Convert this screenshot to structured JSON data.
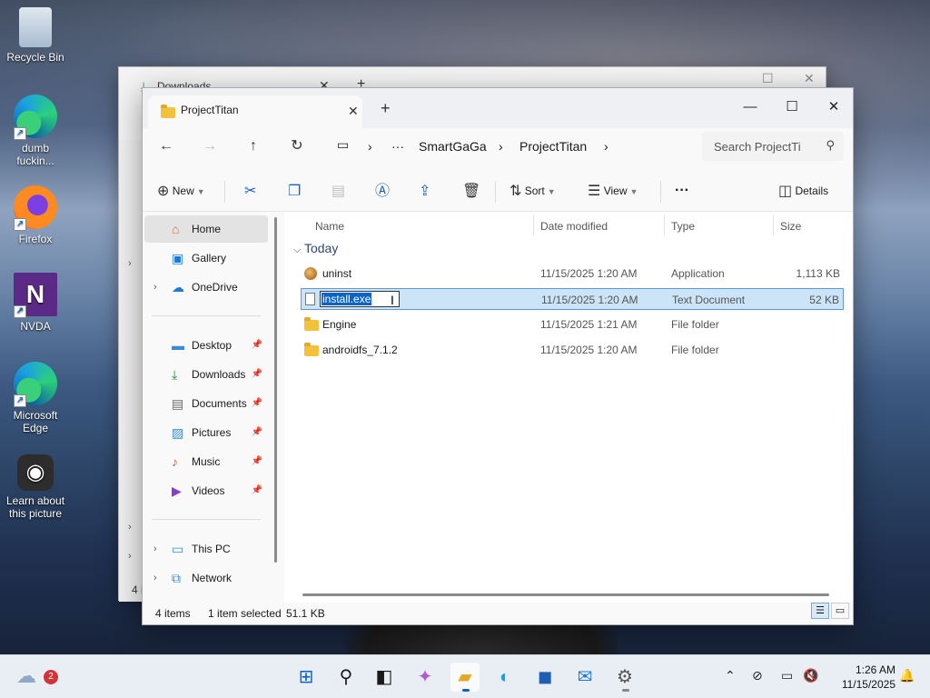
{
  "desktop": {
    "icons": [
      {
        "label": "Recycle Bin",
        "icon": "recycle-bin-icon"
      },
      {
        "label": "dumb fuckin...",
        "icon": "edge-icon"
      },
      {
        "label": "Firefox",
        "icon": "firefox-icon"
      },
      {
        "label": "NVDA",
        "icon": "nvda-icon"
      },
      {
        "label": "Microsoft Edge",
        "icon": "edge-icon"
      },
      {
        "label": "Learn about this picture",
        "icon": "learn-picture-icon"
      }
    ]
  },
  "back_window": {
    "tab_title": "Downloads",
    "footer": "4 i"
  },
  "window": {
    "tab_title": "ProjectTitan",
    "breadcrumb": [
      "SmartGaGa",
      "ProjectTitan"
    ],
    "search_placeholder": "Search ProjectTi",
    "commands": {
      "new": "New",
      "sort": "Sort",
      "view": "View",
      "details": "Details"
    },
    "nav": {
      "home": "Home",
      "gallery": "Gallery",
      "onedrive": "OneDrive",
      "desktop": "Desktop",
      "downloads": "Downloads",
      "documents": "Documents",
      "pictures": "Pictures",
      "music": "Music",
      "videos": "Videos",
      "thispc": "This PC",
      "network": "Network"
    },
    "columns": {
      "name": "Name",
      "date": "Date modified",
      "type": "Type",
      "size": "Size"
    },
    "group_label": "Today",
    "files": [
      {
        "name": "uninst",
        "date": "11/15/2025 1:20 AM",
        "type": "Application",
        "size": "1,113 KB"
      },
      {
        "name": "install.exe",
        "date": "11/15/2025 1:20 AM",
        "type": "Text Document",
        "size": "52 KB"
      },
      {
        "name": "Engine",
        "date": "11/15/2025 1:21 AM",
        "type": "File folder",
        "size": ""
      },
      {
        "name": "androidfs_7.1.2",
        "date": "11/15/2025 1:20 AM",
        "type": "File folder",
        "size": ""
      }
    ],
    "rename_value": "install.exe",
    "status": {
      "count": "4 items",
      "selected": "1 item selected",
      "size": "51.1 KB"
    }
  },
  "taskbar": {
    "weather_badge": "2",
    "time": "1:26 AM",
    "date": "11/15/2025"
  },
  "colors": {
    "accent": "#0a64c8",
    "selection_bg": "#cce4f7",
    "folder": "#f3c13a"
  }
}
